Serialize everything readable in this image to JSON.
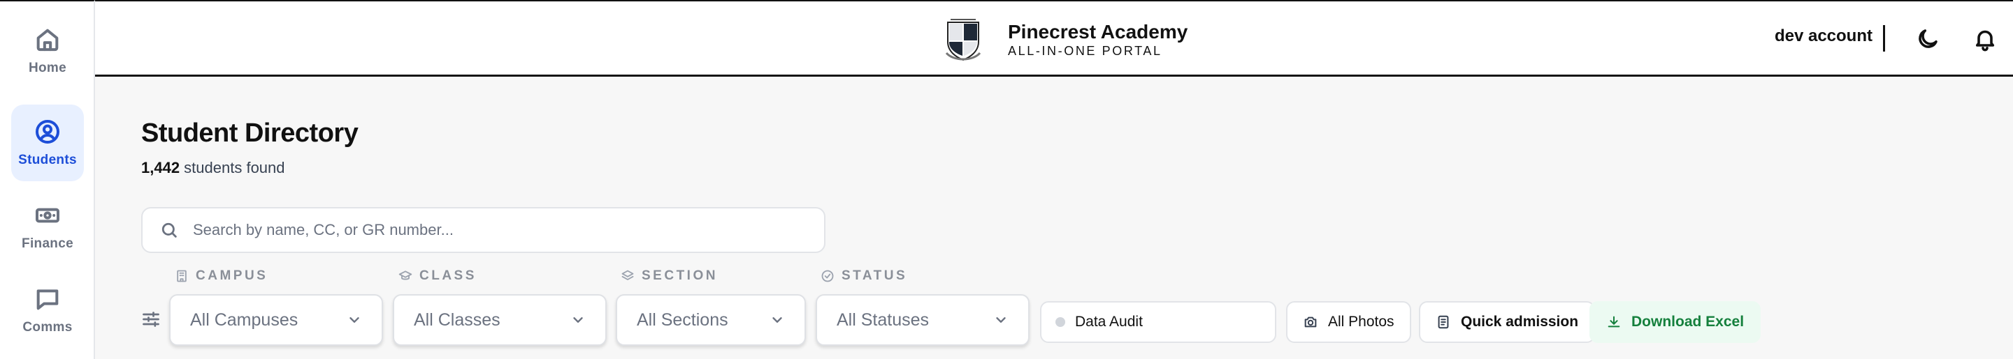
{
  "nav": {
    "items": [
      {
        "label": "Home",
        "icon": "home-icon",
        "active": false
      },
      {
        "label": "Students",
        "icon": "user-circle-icon",
        "active": true
      },
      {
        "label": "Finance",
        "icon": "banknote-icon",
        "active": false
      },
      {
        "label": "Comms",
        "icon": "chat-icon",
        "active": false
      }
    ]
  },
  "header": {
    "school_name": "Pinecrest Academy",
    "portal_name": "ALL-IN-ONE PORTAL",
    "account_name": "dev account"
  },
  "main": {
    "title": "Student Directory",
    "count_value": "1,442",
    "count_suffix": " students found",
    "search_placeholder": "Search by name, CC, or GR number..."
  },
  "filters": {
    "campus": {
      "label": "CAMPUS",
      "value": "All Campuses"
    },
    "class": {
      "label": "CLASS",
      "value": "All Classes"
    },
    "section": {
      "label": "SECTION",
      "value": "All Sections"
    },
    "status": {
      "label": "STATUS",
      "value": "All Statuses"
    }
  },
  "actions": {
    "data_audit": "Data Audit",
    "all_photos": "All Photos",
    "quick_admission": "Quick admission",
    "download_excel": "Download Excel"
  },
  "colors": {
    "active_nav_bg": "#e8f0ff",
    "active_nav_text": "#1d4ed8",
    "excel_text": "#15803d",
    "excel_bg": "#ecfaf2"
  }
}
